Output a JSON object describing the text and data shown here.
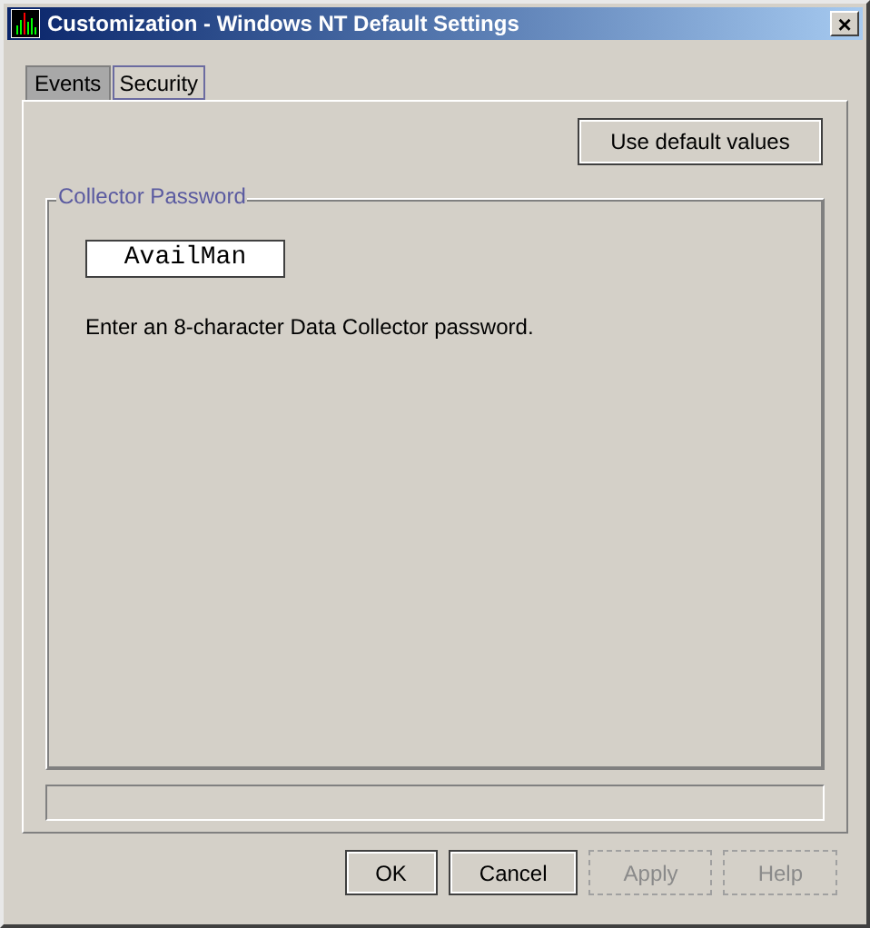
{
  "window": {
    "title": "Customization - Windows NT Default Settings",
    "close": "×"
  },
  "tabs": [
    {
      "label": "Events",
      "selected": true
    },
    {
      "label": "Security",
      "selected": false
    }
  ],
  "default_button": "Use default values",
  "group": {
    "title": "Collector Password",
    "password": {
      "value": "AvailMan"
    },
    "hint": "Enter an 8-character Data Collector password."
  },
  "buttons": [
    {
      "label": "OK",
      "disabled": false
    },
    {
      "label": "Cancel",
      "disabled": false
    },
    {
      "label": "Apply",
      "disabled": true
    },
    {
      "label": "Help",
      "disabled": true
    }
  ]
}
